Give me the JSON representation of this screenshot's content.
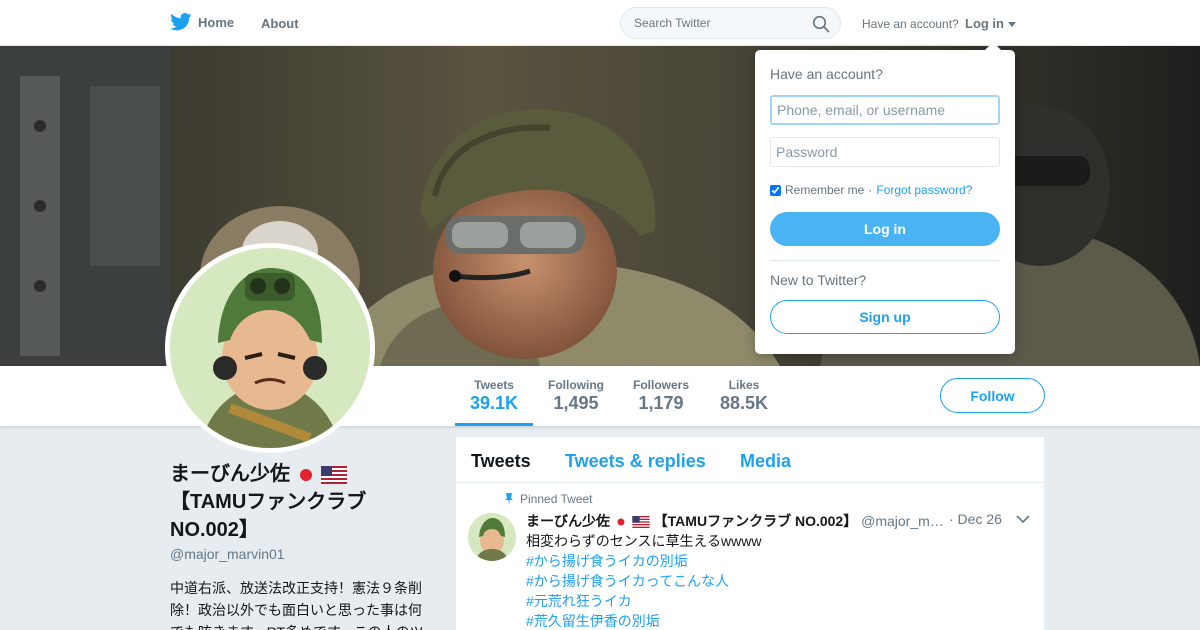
{
  "nav": {
    "home_label": "Home",
    "about_label": "About",
    "search_placeholder": "Search Twitter",
    "have_account": "Have an account?",
    "login_label": "Log in"
  },
  "profile": {
    "name": "まーびん少佐",
    "name_suffix": "【TAMUファンクラブ NO.002】",
    "handle": "@major_marvin01",
    "bio": "中道右派、放送法改正支持！憲法９条削除！政治以外でも面白いと思った事は何でも呟きます。RT多めです。この人のツ",
    "follow_label": "Follow",
    "stats": [
      {
        "label": "Tweets",
        "value": "39.1K"
      },
      {
        "label": "Following",
        "value": "1,495"
      },
      {
        "label": "Followers",
        "value": "1,179"
      },
      {
        "label": "Likes",
        "value": "88.5K"
      }
    ]
  },
  "timeline": {
    "tabs": [
      "Tweets",
      "Tweets & replies",
      "Media"
    ],
    "pinned_label": "Pinned Tweet",
    "tweet": {
      "name": "まーびん少佐",
      "name_suffix": "【TAMUファンクラブ NO.002】",
      "handle": "@major_m…",
      "date": "· Dec 26",
      "text": "相変わらずのセンスに草生えるwwww",
      "hashtags": [
        "#から揚げ食うイカの別垢",
        "#から揚げ食うイカってこんな人",
        "#元荒れ狂うイカ",
        "#荒久留生伊香の別垢"
      ]
    }
  },
  "login_dropdown": {
    "title": "Have an account?",
    "username_placeholder": "Phone, email, or username",
    "password_placeholder": "Password",
    "remember_label": "Remember me",
    "separator": "·",
    "forgot_label": "Forgot password?",
    "login_button": "Log in",
    "new_label": "New to Twitter?",
    "signup_button": "Sign up"
  },
  "colors": {
    "accent": "#1da1f2",
    "login_button": "#4ab3f4",
    "background": "#e6ecf0"
  },
  "icons": [
    "twitter-bird-icon",
    "home-icon",
    "search-icon",
    "caret-down-icon",
    "pin-icon",
    "japan-flag-icon",
    "us-flag-icon"
  ]
}
